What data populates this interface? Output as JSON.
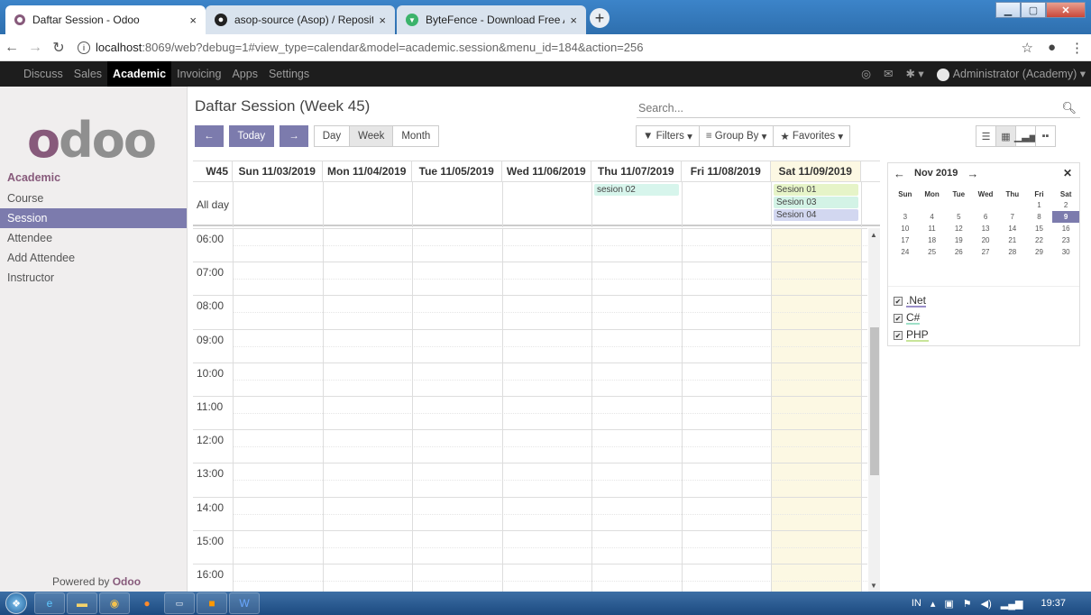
{
  "browser": {
    "tabs": [
      {
        "title": "Daftar Session - Odoo",
        "icon": "odoo-icon",
        "active": true
      },
      {
        "title": "asop-source (Asop) / Repositorie",
        "icon": "github-icon",
        "active": false
      },
      {
        "title": "ByteFence - Download Free Antiv",
        "icon": "bytefence-icon",
        "active": false
      }
    ],
    "close_glyph": "×",
    "newtab_glyph": "+",
    "url_host": "localhost",
    "url_rest": ":8069/web?debug=1#view_type=calendar&model=academic.session&menu_id=184&action=256"
  },
  "topbar": {
    "menus": [
      "Discuss",
      "Sales",
      "Academic",
      "Invoicing",
      "Apps",
      "Settings"
    ],
    "active_menu": "Academic",
    "user": "Administrator (Academy)"
  },
  "sidebar": {
    "section": "Academic",
    "items": [
      "Course",
      "Session",
      "Attendee",
      "Add Attendee",
      "Instructor"
    ],
    "active_item": "Session",
    "powered_prefix": "Powered by ",
    "powered_brand": "Odoo"
  },
  "control": {
    "title": "Daftar Session (Week 45)",
    "search_placeholder": "Search...",
    "today": "Today",
    "day": "Day",
    "week": "Week",
    "month": "Month",
    "filters": "Filters",
    "group_by": "Group By",
    "favorites": "Favorites"
  },
  "calendar": {
    "week_label": "W45",
    "days": [
      "Sun 11/03/2019",
      "Mon 11/04/2019",
      "Tue 11/05/2019",
      "Wed 11/06/2019",
      "Thu 11/07/2019",
      "Fri 11/08/2019",
      "Sat 11/09/2019"
    ],
    "today_index": 6,
    "allday_label": "All day",
    "events": [
      {
        "title": "sesion 02",
        "day": 4,
        "slot": 0,
        "color": "#d7f5ec"
      },
      {
        "title": "Sesion 01",
        "day": 6,
        "slot": 0,
        "color": "#e6f4c8"
      },
      {
        "title": "Sesion 03",
        "day": 6,
        "slot": 1,
        "color": "#d3f3e6"
      },
      {
        "title": "Sesion 04",
        "day": 6,
        "slot": 2,
        "color": "#d2d7f0"
      }
    ],
    "hours": [
      "06:00",
      "07:00",
      "08:00",
      "09:00",
      "10:00",
      "11:00",
      "12:00",
      "13:00",
      "14:00",
      "15:00",
      "16:00"
    ]
  },
  "mini_calendar": {
    "month": "Nov 2019",
    "weekdays": [
      "Sun",
      "Mon",
      "Tue",
      "Wed",
      "Thu",
      "Fri",
      "Sat"
    ],
    "weeks": [
      [
        "",
        "",
        "",
        "",
        "",
        "1",
        "2"
      ],
      [
        "3",
        "4",
        "5",
        "6",
        "7",
        "8",
        "9"
      ],
      [
        "10",
        "11",
        "12",
        "13",
        "14",
        "15",
        "16"
      ],
      [
        "17",
        "18",
        "19",
        "20",
        "21",
        "22",
        "23"
      ],
      [
        "24",
        "25",
        "26",
        "27",
        "28",
        "29",
        "30"
      ]
    ],
    "selected": "9",
    "legend": [
      {
        "label": ".Net",
        "color": "#9a8ec9",
        "checked": true
      },
      {
        "label": "C#",
        "color": "#9fe0c8",
        "checked": true
      },
      {
        "label": "PHP",
        "color": "#c8e59a",
        "checked": true
      }
    ]
  },
  "taskbar": {
    "lang": "IN",
    "clock": "19:37"
  }
}
